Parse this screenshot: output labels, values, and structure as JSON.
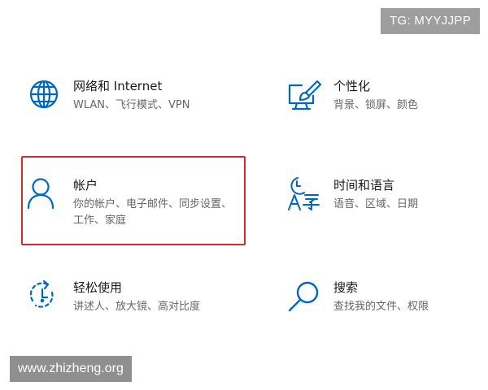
{
  "overlay": {
    "tg_badge": "TG: MYYJJPP",
    "watermark": "www.zhizheng.org"
  },
  "accent_color": "#0067c0",
  "selection_color": "#d9292c",
  "settings": {
    "network": {
      "title": "网络和 Internet",
      "description": "WLAN、飞行模式、VPN",
      "icon": "globe-icon"
    },
    "personalization": {
      "title": "个性化",
      "description": "背景、锁屏、颜色",
      "icon": "personalization-icon"
    },
    "accounts": {
      "title": "帐户",
      "description": "你的帐户、电子邮件、同步设置、工作、家庭",
      "icon": "person-icon",
      "selected": true
    },
    "time_language": {
      "title": "时间和语言",
      "description": "语音、区域、日期",
      "icon": "time-language-icon"
    },
    "ease_of_access": {
      "title": "轻松使用",
      "description": "讲述人、放大镜、高对比度",
      "icon": "ease-of-access-icon"
    },
    "search": {
      "title": "搜索",
      "description": "查找我的文件、权限",
      "icon": "search-icon"
    }
  }
}
